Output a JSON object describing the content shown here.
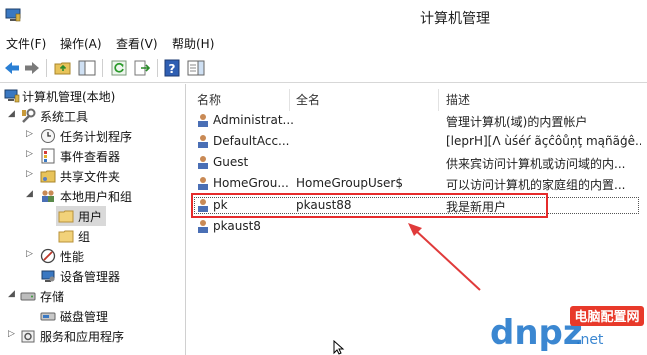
{
  "window": {
    "title": "计算机管理"
  },
  "menu": [
    "文件(F)",
    "操作(A)",
    "查看(V)",
    "帮助(H)"
  ],
  "tree": {
    "root": "计算机管理(本地)",
    "system_tools": "系统工具",
    "task_scheduler": "任务计划程序",
    "event_viewer": "事件查看器",
    "shared_folders": "共享文件夹",
    "local_users_groups": "本地用户和组",
    "users": "用户",
    "groups": "组",
    "performance": "性能",
    "device_manager": "设备管理器",
    "storage": "存储",
    "disk_management": "磁盘管理",
    "services_apps": "服务和应用程序"
  },
  "list": {
    "columns": [
      "名称",
      "全名",
      "描述"
    ],
    "rows": [
      {
        "name": "Administrat...",
        "fullname": "",
        "desc": "管理计算机(域)的内置帐户"
      },
      {
        "name": "DefaultAcc...",
        "fullname": "",
        "desc": "[leprH][Λ ùśéŕ ãçĉôůņţ mąñãģê..."
      },
      {
        "name": "Guest",
        "fullname": "",
        "desc": "供来宾访问计算机或访问域的内..."
      },
      {
        "name": "HomeGrou...",
        "fullname": "HomeGroupUser$",
        "desc": "可以访问计算机的家庭组的内置..."
      },
      {
        "name": "pk",
        "fullname": "pkaust88",
        "desc": "我是新用户"
      },
      {
        "name": "pkaust8",
        "fullname": "",
        "desc": ""
      }
    ]
  },
  "watermark": {
    "brand": "dnpz",
    "suffix": ".net",
    "badge": "电脑配置网"
  },
  "colors": {
    "highlight": "#e52b2b",
    "tree_selection": "#d9d9d9",
    "watermark_blue": "#1a73c9"
  }
}
